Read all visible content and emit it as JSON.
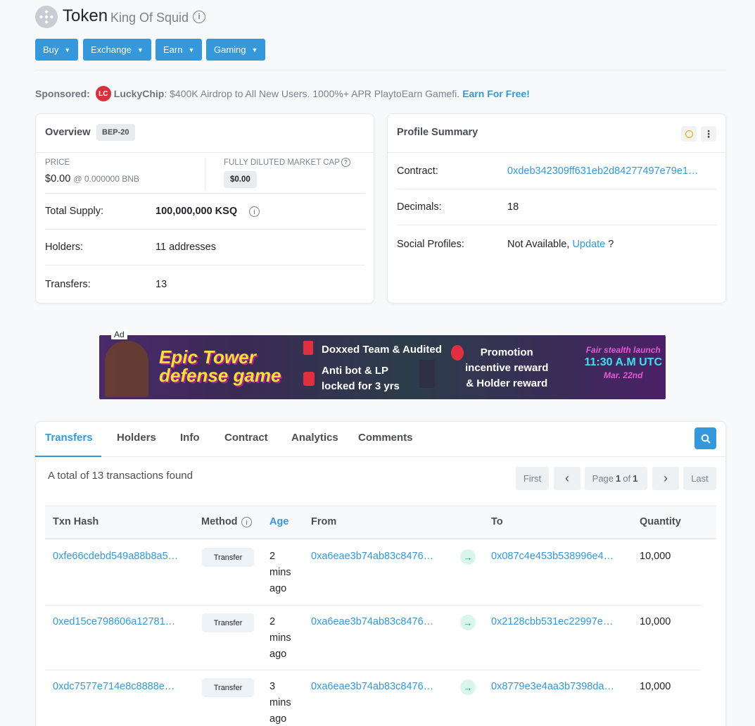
{
  "header": {
    "title": "Token",
    "subtitle": "King Of Squid",
    "logo_icon": "bnb-logo-icon",
    "info_icon": "info-icon"
  },
  "nav": [
    {
      "label": "Buy"
    },
    {
      "label": "Exchange"
    },
    {
      "label": "Earn"
    },
    {
      "label": "Gaming"
    }
  ],
  "sponsored": {
    "label": "Sponsored:",
    "brand": "LuckyChip",
    "text": ": $400K Airdrop to All New Users. 1000%+ APR PlaytoEarn Gamefi.",
    "cta": "Earn For Free!"
  },
  "overview": {
    "title": "Overview",
    "badge": "BEP-20",
    "price_label": "PRICE",
    "price": "$0.00",
    "price_bnb": "@ 0.000000 BNB",
    "fdmc_label": "FULLY DILUTED MARKET CAP",
    "fdmc_value": "$0.00",
    "supply_label": "Total Supply:",
    "supply_value": "100,000,000",
    "supply_unit": "KSQ",
    "holders_label": "Holders:",
    "holders_value": "11 addresses",
    "transfers_label": "Transfers:",
    "transfers_value": "13"
  },
  "profile": {
    "title": "Profile Summary",
    "contract_label": "Contract:",
    "contract_value": "0xdeb342309ff631eb2d84277497e79e1…",
    "decimals_label": "Decimals:",
    "decimals_value": "18",
    "social_label": "Social Profiles:",
    "social_value": "Not Available,",
    "social_link": "Update",
    "social_q": "?"
  },
  "ad": {
    "label": "Ad",
    "title_line1": "Epic Tower",
    "title_line2": "defense game",
    "block1_line1": "Doxxed Team & Audited",
    "block1_line2": "Anti bot & LP",
    "block1_line3": "locked for 3 yrs",
    "block2_line1": "Promotion",
    "block2_line2": "incentive reward",
    "block2_line3": "& Holder reward",
    "right_line1": "Fair stealth launch",
    "right_time": "11:30 A.M UTC",
    "right_date": "Mar. 22nd"
  },
  "tabs": [
    {
      "label": "Transfers"
    },
    {
      "label": "Holders"
    },
    {
      "label": "Info"
    },
    {
      "label": "Contract"
    },
    {
      "label": "Analytics"
    },
    {
      "label": "Comments"
    }
  ],
  "list": {
    "total_text": "A total of 13 transactions found",
    "pager": {
      "first": "First",
      "prev": "‹",
      "page_prefix": "Page",
      "page_current": "1",
      "page_of": "of",
      "page_total": "1",
      "next": "›",
      "last": "Last"
    },
    "columns": {
      "hash": "Txn Hash",
      "method": "Method",
      "age": "Age",
      "from": "From",
      "to": "To",
      "qty": "Quantity"
    },
    "rows": [
      {
        "hash": "0xfe66cdebd549a88b8a5…",
        "method": "Transfer",
        "age1": "2",
        "age2": "mins",
        "age3": "ago",
        "from": "0xa6eae3b74ab83c8476…",
        "to": "0x087c4e453b538996e4…",
        "qty": "10,000"
      },
      {
        "hash": "0xed15ce798606a12781…",
        "method": "Transfer",
        "age1": "2",
        "age2": "mins",
        "age3": "ago",
        "from": "0xa6eae3b74ab83c8476…",
        "to": "0x2128cbb531ec22997e…",
        "qty": "10,000"
      },
      {
        "hash": "0xdc7577e714e8c8888e…",
        "method": "Transfer",
        "age1": "3",
        "age2": "mins",
        "age3": "ago",
        "from": "0xa6eae3b74ab83c8476…",
        "to": "0x8779e3e4aa3b7398da…",
        "qty": "10,000"
      }
    ]
  },
  "colors": {
    "accent": "#3498db",
    "muted": "#77838f",
    "success": "#00a186"
  }
}
